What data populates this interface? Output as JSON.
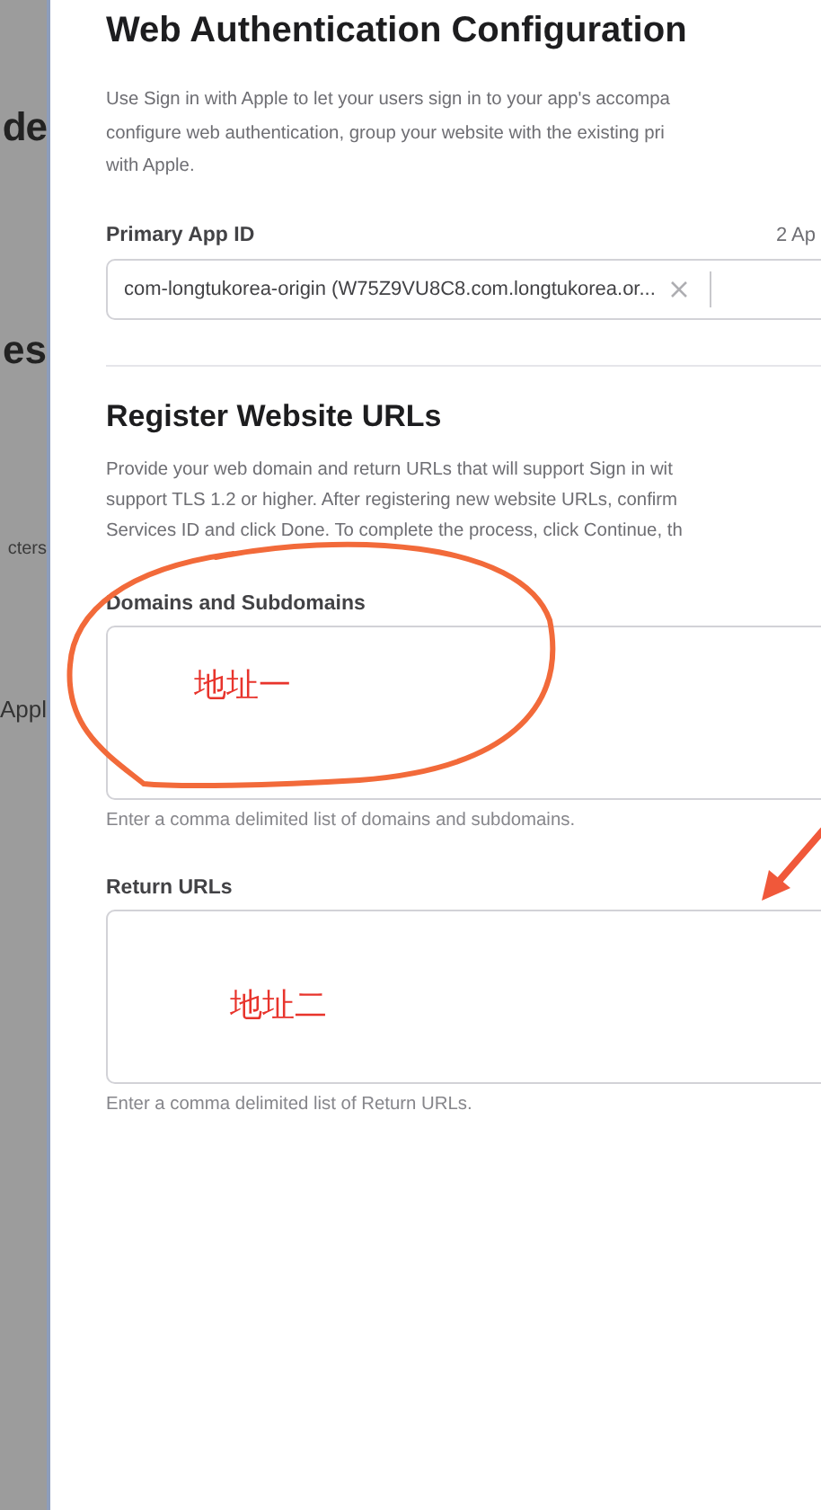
{
  "backdrop": [
    {
      "kind": "title",
      "text": "de"
    },
    {
      "kind": "section",
      "text": "es"
    },
    {
      "kind": "cell",
      "text": "cters"
    },
    {
      "kind": "row",
      "text": "Appl"
    }
  ],
  "panel": {
    "title": "Web Authentication Configuration",
    "intro_lines": [
      "Use Sign in with Apple to let your users sign in to your app's accompa",
      "configure web authentication, group your website with the existing pri",
      "with Apple."
    ],
    "primary_app_id": {
      "label": "Primary App ID",
      "count": "2 Ap",
      "value": "com-longtukorea-origin (W75Z9VU8C8.com.longtukorea.or..."
    },
    "register": {
      "title": "Register Website URLs",
      "lines": [
        "Provide your web domain and return URLs that will support Sign in wit",
        "support TLS 1.2 or higher. After registering new website URLs, confirm",
        "Services ID and click Done. To complete the process, click Continue, th"
      ],
      "fields": [
        {
          "label": "Domains and Subdomains",
          "annotation": "地址一",
          "help": "Enter a comma delimited list of domains and subdomains."
        },
        {
          "label": "Return URLs",
          "annotation": "地址二",
          "help": "Enter a comma delimited list of Return URLs."
        }
      ]
    }
  }
}
